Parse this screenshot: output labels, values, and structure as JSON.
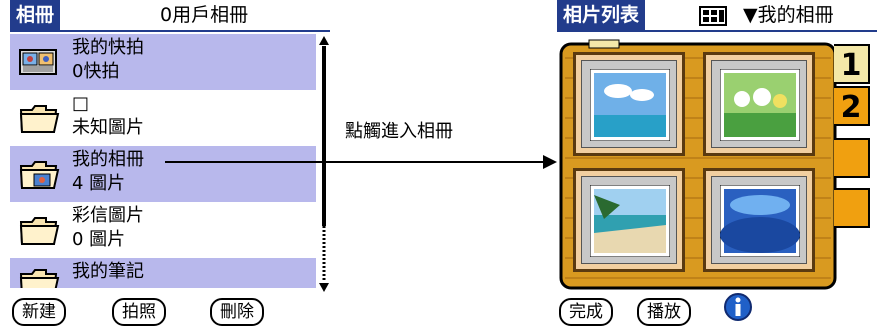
{
  "left": {
    "tab_label": "相冊",
    "count_label": "0用戶相冊",
    "items": [
      {
        "name": "我的快拍",
        "sub": "0快拍",
        "highlight": true,
        "icon": "camera-album-icon"
      },
      {
        "name": "□",
        "sub": "未知圖片",
        "highlight": false,
        "icon": "folder-icon"
      },
      {
        "name": "我的相冊",
        "sub": "4 圖片",
        "highlight": true,
        "icon": "photo-folder-icon"
      },
      {
        "name": "彩信圖片",
        "sub": "0 圖片",
        "highlight": false,
        "icon": "folder-icon"
      },
      {
        "name": "我的筆記",
        "sub": "",
        "highlight": true,
        "icon": "folder-icon"
      }
    ],
    "buttons": {
      "new": "新建",
      "photo": "拍照",
      "delete": "刪除"
    }
  },
  "annotation": "點觸進入相冊",
  "right": {
    "tab_label": "相片列表",
    "album_selector": "▼我的相冊",
    "page_tabs": [
      "1",
      "2",
      "",
      ""
    ],
    "thumbnails": [
      "sky-sea-photo",
      "flowers-field-photo",
      "beach-palm-photo",
      "ocean-wave-photo"
    ],
    "buttons": {
      "done": "完成",
      "play": "播放"
    },
    "info_icon": "info-icon",
    "colors": {
      "accent": "#223c8c",
      "highlight": "#b8b8ec",
      "book": "#d99a20"
    }
  }
}
